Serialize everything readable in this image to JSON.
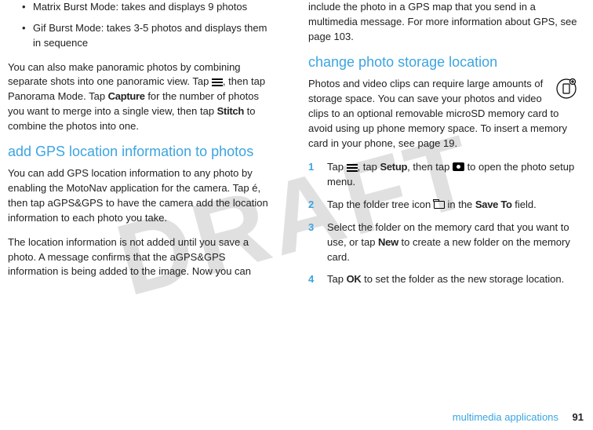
{
  "watermark": "DRAFT",
  "left": {
    "bullets": [
      "Matrix Burst Mode: takes and displays 9 photos",
      "Gif Burst Mode: takes 3-5 photos and displays them in sequence"
    ],
    "para_pano_a": "You can also make panoramic photos by combining separate shots into one panoramic view. Tap ",
    "para_pano_b": ", then tap Panorama Mode. Tap ",
    "capture": "Capture",
    "para_pano_c": " for the number of photos you want to merge into a single view, then tap ",
    "stitch": "Stitch",
    "para_pano_d": " to combine the photos into one.",
    "h2_gps": "add GPS location information to photos",
    "para_gps1": "You can add GPS location information to any photo by enabling the MotoNav application for the camera. Tap é, then tap aGPS&GPS to have the camera add the location information to each photo you take.",
    "para_gps2": "The location information is not added until you save a photo. A message confirms that the aGPS&GPS information is being added to the image. Now you can "
  },
  "right": {
    "para_cont": "include the photo in a GPS map that you send in a multimedia message. For more information about GPS, see page 103.",
    "h2_storage": "change photo storage location",
    "para_storage": "Photos and video clips can require large amounts of storage space. You can save your photos and video clips to an optional removable microSD memory card to avoid using up phone memory space. To insert a memory card in your phone, see page 19.",
    "step1_a": "Tap ",
    "step1_b": ", tap ",
    "setup": "Setup",
    "step1_c": ", then tap ",
    "step1_d": " to open the photo setup menu.",
    "step2_a": "Tap the folder tree icon ",
    "step2_b": " in the ",
    "saveto": "Save To",
    "step2_c": " field.",
    "step3_a": "Select the folder on the memory card that you want to use, or tap ",
    "new": "New",
    "step3_b": " to create a new folder on the memory card.",
    "step4_a": "Tap ",
    "ok": "OK",
    "step4_b": " to set the folder as the new storage location."
  },
  "footer": {
    "section": "multimedia applications",
    "page": "91"
  }
}
